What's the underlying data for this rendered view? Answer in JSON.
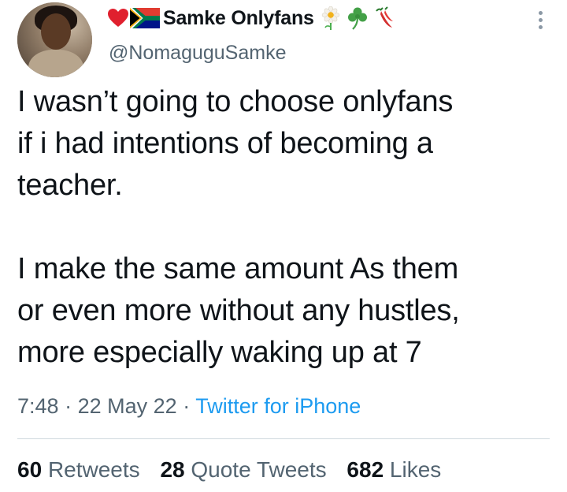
{
  "author": {
    "display_name": "Samke Onlyfans",
    "handle": "@NomaguguSamke",
    "name_emojis": [
      "red-heart",
      "south-africa-flag"
    ],
    "suffix_emojis": [
      "daisy-blossom",
      "shamrock",
      "chili-pepper"
    ]
  },
  "tweet": {
    "text": "I wasn’t going to choose onlyfans\nif i had intentions of becoming a\nteacher.\n\nI make the same amount As them\nor even more without any hustles,\nmore especially waking up at 7",
    "time": "7:48",
    "date": "22 May 22",
    "separator": "·",
    "source": "Twitter for iPhone"
  },
  "stats": {
    "retweets_count": "60",
    "retweets_label": "Retweets",
    "quotes_count": "28",
    "quotes_label": "Quote Tweets",
    "likes_count": "682",
    "likes_label": "Likes"
  },
  "colors": {
    "text": "#0f1419",
    "secondary": "#536471",
    "link": "#1d9bf0",
    "divider": "#cfd9de"
  }
}
